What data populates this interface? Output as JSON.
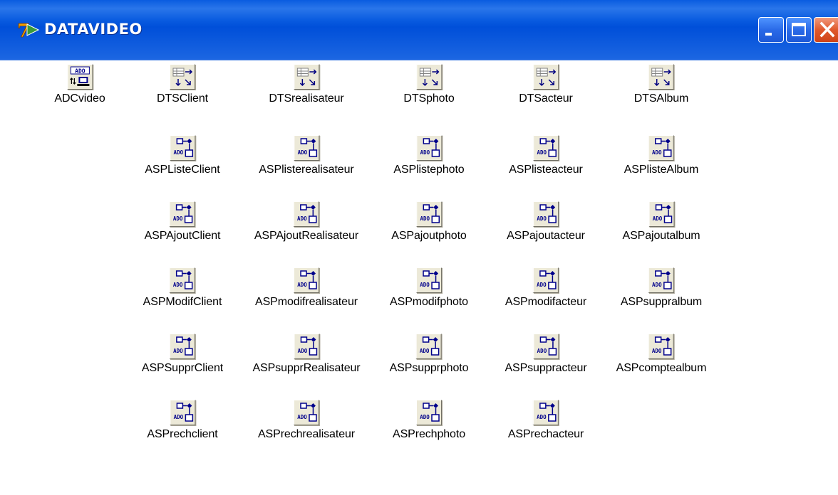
{
  "window": {
    "title": "DATAVIDEO",
    "buttons": {
      "minimize": "minimize",
      "maximize": "maximize",
      "close": "close"
    }
  },
  "colors": {
    "titlebar": "#0a5ce0",
    "title_text": "#ffffff",
    "icon_bg": "#ece9d8",
    "icon_blue": "#00008b"
  },
  "components": {
    "adc": {
      "label": "ADCvideo",
      "icon": "adc-connection-icon"
    },
    "dataset_row": [
      {
        "label": "DTSClient",
        "icon": "dataset-provider-icon"
      },
      {
        "label": "DTSrealisateur",
        "icon": "dataset-provider-icon"
      },
      {
        "label": "DTSphoto",
        "icon": "dataset-provider-icon"
      },
      {
        "label": "DTSacteur",
        "icon": "dataset-provider-icon"
      },
      {
        "label": "DTSAlbum",
        "icon": "dataset-provider-icon"
      }
    ],
    "grid": [
      [
        "ASPListeClient",
        "ASPlisterealisateur",
        "ASPlistephoto",
        "ASPlisteacteur",
        "ASPlisteAlbum"
      ],
      [
        "ASPAjoutClient",
        "ASPAjoutRealisateur",
        "ASPajoutphoto",
        "ASPajoutacteur",
        "ASPajoutalbum"
      ],
      [
        "ASPModifClient",
        "ASPmodifrealisateur",
        "ASPmodifphoto",
        "ASPmodifacteur",
        "ASPsuppralbum"
      ],
      [
        "ASPSupprClient",
        "ASPsupprRealisateur",
        "ASPsupprphoto",
        "ASPsuppracteur",
        "ASPcomptealbum"
      ],
      [
        "ASPrechclient",
        "ASPrechrealisateur",
        "ASPrechphoto",
        "ASPrechacteur"
      ]
    ],
    "grid_icon": "ado-command-icon"
  }
}
